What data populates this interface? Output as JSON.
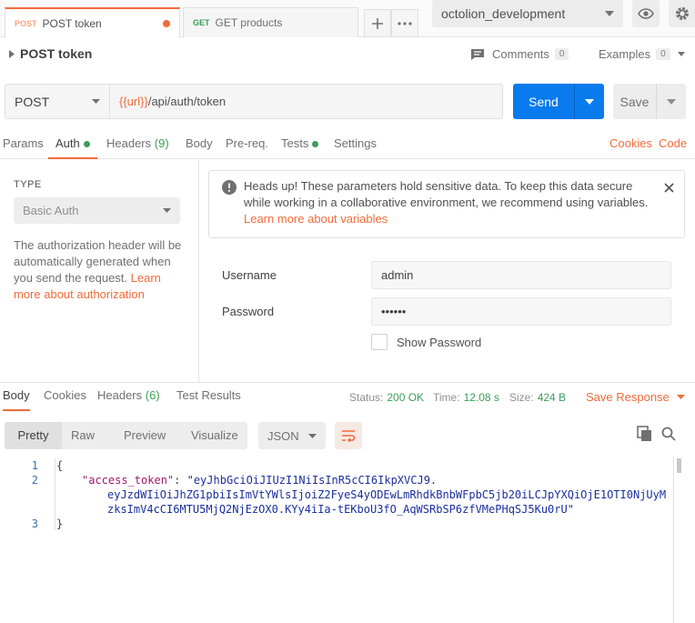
{
  "tabs": [
    {
      "method": "POST",
      "label": "POST token",
      "modified": true
    },
    {
      "method": "GET",
      "label": "GET products"
    }
  ],
  "environment": {
    "selected": "octolion_development"
  },
  "request": {
    "title": "POST token",
    "comments_label": "Comments",
    "comments_count": "0",
    "examples_label": "Examples",
    "examples_count": "0",
    "method": "POST",
    "url_var": "{{url}}",
    "url_path": "/api/auth/token",
    "send_label": "Send",
    "save_label": "Save"
  },
  "request_tabs": {
    "params": "Params",
    "auth": "Auth",
    "headers": "Headers",
    "headers_count": "(9)",
    "body": "Body",
    "prereq": "Pre-req.",
    "tests": "Tests",
    "settings": "Settings",
    "cookies": "Cookies",
    "code": "Code"
  },
  "auth": {
    "type_label": "TYPE",
    "type_value": "Basic Auth",
    "description": "The authorization header will be automatically generated when you send the request. ",
    "description_link": "Learn more about authorization",
    "alert_text": "Heads up! These parameters hold sensitive data. To keep this data secure while working in a collaborative environment, we recommend using variables. ",
    "alert_link": "Learn more about variables",
    "username_label": "Username",
    "username_value": "admin",
    "password_label": "Password",
    "password_value": "••••••",
    "show_password_label": "Show Password"
  },
  "response": {
    "tabs": {
      "body": "Body",
      "cookies": "Cookies",
      "headers": "Headers",
      "headers_count": "(6)",
      "test_results": "Test Results"
    },
    "status_label": "Status:",
    "status_value": "200 OK",
    "time_label": "Time:",
    "time_value": "12.08 s",
    "size_label": "Size:",
    "size_value": "424 B",
    "save_response_label": "Save Response",
    "modes": [
      "Pretty",
      "Raw",
      "Preview",
      "Visualize"
    ],
    "active_mode": "Pretty",
    "format": "JSON",
    "code": {
      "line_numbers": [
        "1",
        "2",
        "3"
      ],
      "open_brace": "{",
      "key": "\"access_token\"",
      "colon": ": ",
      "value_line1": "\"eyJhbGciOiJIUzI1NiIsInR5cCI6IkpXVCJ9.",
      "value_line2": "eyJzdWIiOiJhZG1pbiIsImVtYWlsIjoiZ2FyeS4yODEwLmRhdkBnbWFpbC5jb20iLCJpYXQiOjE1OTI0NjUyM",
      "value_line3": "zksImV4cCI6MTU5MjQ2NjEzOX0.KYy4iIa-tEKboU3fO_AqWSRbSP6zfVMePHqSJ5Ku0rU\"",
      "close_brace": "}"
    }
  },
  "colors": {
    "accent": "#f26b3a",
    "send_button": "#097bed",
    "status_ok": "#3b9e59"
  }
}
